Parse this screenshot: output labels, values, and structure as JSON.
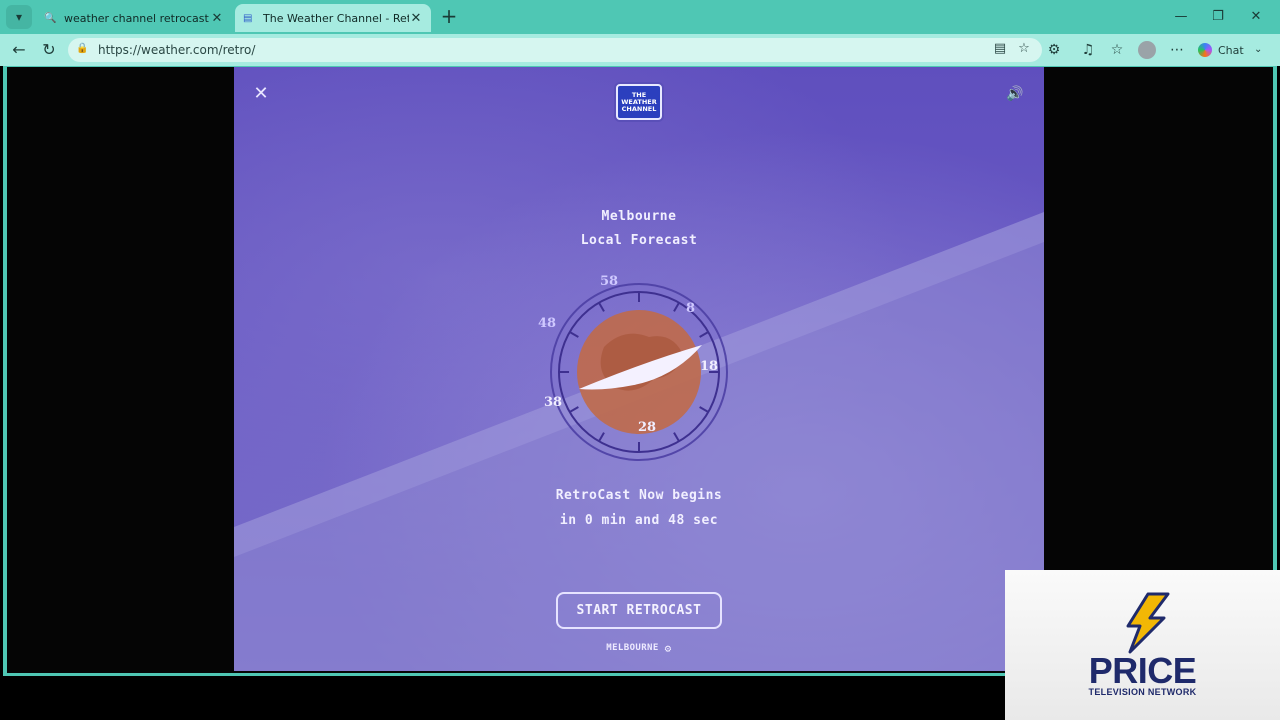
{
  "browser": {
    "tabs": [
      {
        "title": "weather channel retrocast - Search",
        "favicon": "search-icon",
        "active": false
      },
      {
        "title": "The Weather Channel - RetroCast",
        "favicon": "page-icon",
        "active": true
      }
    ],
    "address": "https://weather.com/retro/",
    "chat_label": "Chat"
  },
  "retro": {
    "logo_lines": [
      "THE",
      "WEATHER",
      "CHANNEL"
    ],
    "location": "Melbourne",
    "subtitle": "Local Forecast",
    "dial_labels": [
      "58",
      "8",
      "18",
      "28",
      "38",
      "48"
    ],
    "countdown_line1": "RetroCast Now begins",
    "countdown_line2": "in 0 min and 48 sec",
    "countdown_seconds": 48,
    "start_label": "START RETROCAST",
    "city_label": "MELBOURNE"
  },
  "network": {
    "name": "PRICE",
    "subtitle": "TELEVISION NETWORK"
  },
  "colors": {
    "chrome": "#4fc7b4",
    "toolbar": "#a6ebe0",
    "stage": "#6a5bc4",
    "globe": "#c06a4a",
    "network_text": "#1f2a6b",
    "bolt": "#f2b705"
  }
}
